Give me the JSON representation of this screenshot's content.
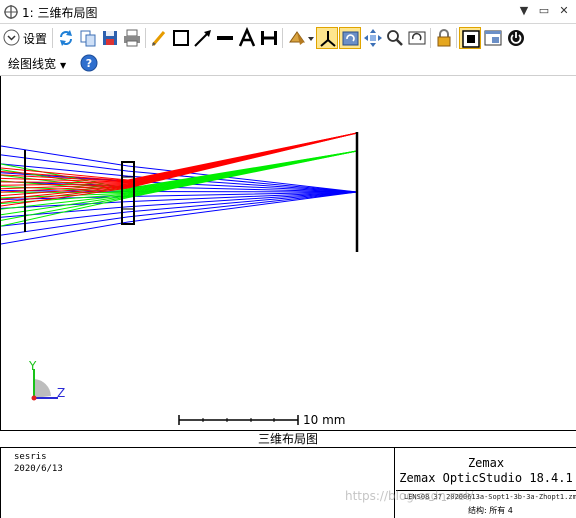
{
  "window": {
    "title": "1: 三维布局图",
    "controls": [
      "▼",
      "▭",
      "✕"
    ]
  },
  "toolbar": {
    "settings_label": "设置",
    "icons": [
      "refresh-icon",
      "copy-icon",
      "save-icon",
      "print-icon",
      "pencil-icon",
      "rectangle-icon",
      "arrow-icon",
      "line-icon",
      "text-icon",
      "dimension-icon",
      "rotate-view-icon",
      "axes-icon",
      "refresh-view-icon",
      "pan-icon",
      "zoom-icon",
      "camera-icon",
      "lock-icon",
      "fit-window-icon",
      "window-icon",
      "power-icon"
    ]
  },
  "toolbar2": {
    "line_width_label": "绘图线宽"
  },
  "canvas": {
    "axis_y": "Y",
    "axis_z": "Z",
    "scale_label": "10 mm",
    "ray_colors": {
      "field1": "#ff0000",
      "field2": "#00ee00",
      "field3": "#0000ff"
    }
  },
  "footer": {
    "title": "三维布局图",
    "author": "sesris",
    "date": "2020/6/13",
    "brand_line1": "Zemax",
    "brand_line2": "Zemax OpticStudio 18.4.1",
    "file": "LENS08_37_20200613a-Sopt1-3b-3a-Zhopt1.zmx",
    "config": "结构: 所有 4"
  },
  "watermark": "https://blog.csdn.net/"
}
